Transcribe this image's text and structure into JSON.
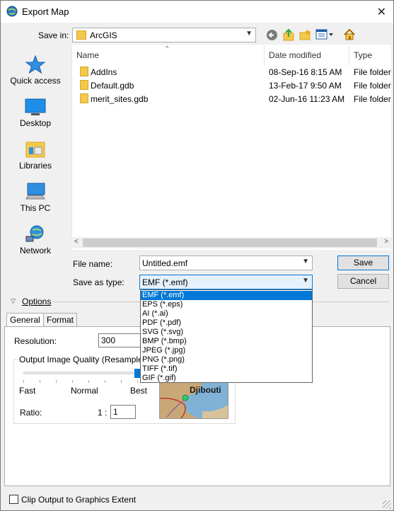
{
  "window": {
    "title": "Export Map",
    "close_glyph": "✕"
  },
  "nav": {
    "save_in_label": "Save in:",
    "save_in_value": "ArcGIS"
  },
  "toolbar": {
    "icons": [
      "back-icon",
      "up-folder-icon",
      "new-folder-icon",
      "view-menu-icon",
      "home-icon"
    ]
  },
  "places": [
    {
      "label": "Quick access",
      "icon": "star-icon"
    },
    {
      "label": "Desktop",
      "icon": "desktop-icon"
    },
    {
      "label": "Libraries",
      "icon": "libraries-icon"
    },
    {
      "label": "This PC",
      "icon": "computer-icon"
    },
    {
      "label": "Network",
      "icon": "network-icon"
    }
  ],
  "filelist": {
    "columns": [
      "Name",
      "Date modified",
      "Type"
    ],
    "rows": [
      {
        "name": "AddIns",
        "date": "08-Sep-16 8:15 AM",
        "type": "File folder"
      },
      {
        "name": "Default.gdb",
        "date": "13-Feb-17 9:50 AM",
        "type": "File folder"
      },
      {
        "name": "merit_sites.gdb",
        "date": "02-Jun-16 11:23 AM",
        "type": "File folder"
      }
    ]
  },
  "form": {
    "file_name_label": "File name:",
    "file_name_value": "Untitled.emf",
    "save_as_type_label": "Save as type:",
    "save_as_type_value": "EMF (*.emf)",
    "save_button": "Save",
    "cancel_button": "Cancel"
  },
  "type_options": [
    "EMF (*.emf)",
    "EPS (*.eps)",
    "AI (*.ai)",
    "PDF (*.pdf)",
    "SVG (*.svg)",
    "BMP (*.bmp)",
    "JPEG (*.jpg)",
    "PNG (*.png)",
    "TIFF (*.tif)",
    "GIF (*.gif)"
  ],
  "options": {
    "header": "Options",
    "tabs": [
      "General",
      "Format"
    ],
    "resolution_label": "Resolution:",
    "resolution_value": "300",
    "quality_group_label": "Output Image Quality (Resample Ra",
    "quality_ticks": [
      "Fast",
      "Normal",
      "Best"
    ],
    "quality_level": 1.0,
    "ratio_label": "Ratio:",
    "ratio_prefix": "1 :",
    "ratio_value": "1",
    "map_label": "Djibouti",
    "clip_label": "Clip Output to Graphics Extent"
  }
}
